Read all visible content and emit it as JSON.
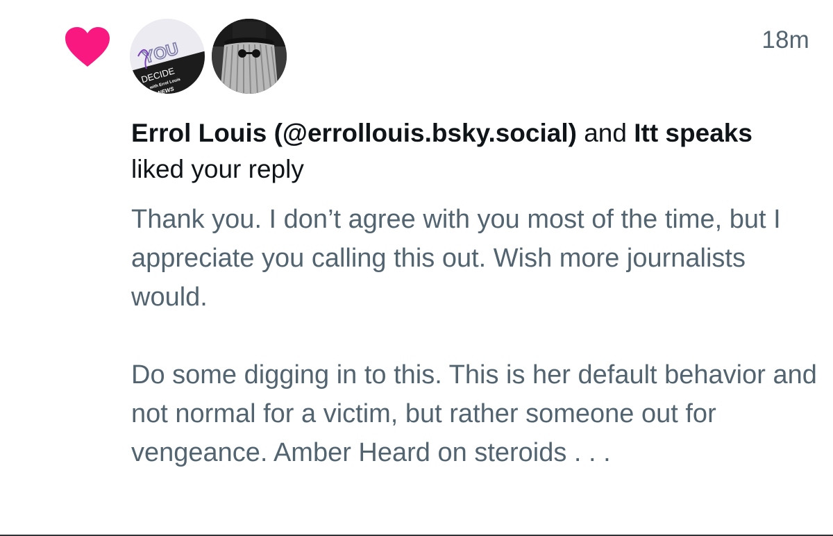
{
  "notification": {
    "type_icon": "heart-icon",
    "accent_color": "#f91880",
    "timestamp": "18m",
    "avatars": [
      {
        "name": "you-decide-avatar",
        "logo_text": "YOU DECIDE with Errol Louis SPECTRUM NEWS"
      },
      {
        "name": "itt-speaks-avatar"
      }
    ],
    "headline": {
      "actor_1": "Errol Louis (@errollouis.bsky.social)",
      "connector": " and ",
      "actor_2": "Itt speaks",
      "action": " liked your reply"
    },
    "post": {
      "paragraph_1": "Thank you. I don’t agree with you most of the time, but I appreciate you calling this out. Wish more journalists would.",
      "paragraph_2": "Do some digging in to this. This is her default behavior and not normal for a victim, but rather someone out for vengeance. Amber Heard on steroids . . ."
    }
  }
}
